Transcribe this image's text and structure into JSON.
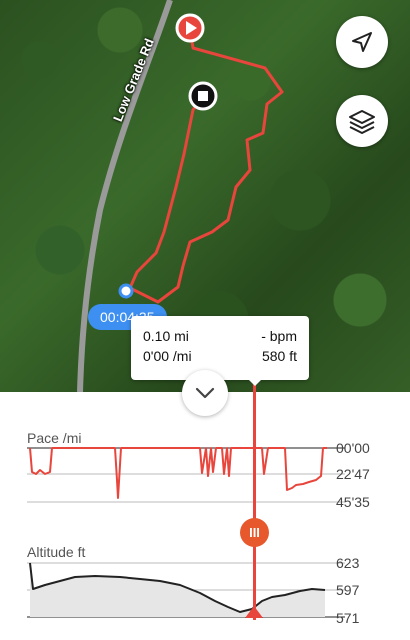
{
  "map": {
    "road_label": "Low Grade Rd",
    "start_marker": "play-icon",
    "end_marker": "stop-icon",
    "locate_button_icon": "navigation-arrow-icon",
    "layers_button_icon": "layers-icon",
    "route_color": "#e8453c"
  },
  "time_badge": "00:04:35",
  "stats": {
    "distance": "0.10 mi",
    "heart_rate": "- bpm",
    "pace": "0'00 /mi",
    "altitude": "580 ft"
  },
  "collapse_icon": "chevron-down-icon",
  "pace_chart": {
    "title": "Pace /mi",
    "ticks": [
      "00'00",
      "22'47",
      "45'35"
    ]
  },
  "altitude_chart": {
    "title": "Altitude ft",
    "ticks": [
      "623",
      "597",
      "571"
    ]
  },
  "scrubber": {
    "handle_label": "III"
  },
  "accent_color": "#e8453c"
}
